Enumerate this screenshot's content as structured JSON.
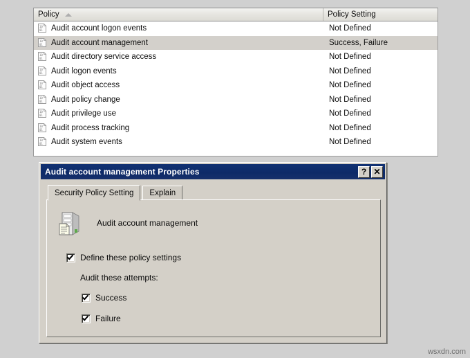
{
  "list": {
    "columns": [
      {
        "key": "policy",
        "label": "Policy",
        "sorted": true,
        "sort_direction": "ascending",
        "sort_icon": "sort-ascending-arrow-icon"
      },
      {
        "key": "setting",
        "label": "Policy Setting",
        "sorted": false
      }
    ],
    "rows": [
      {
        "icon": "audit-policy-icon",
        "policy": "Audit account logon events",
        "setting": "Not Defined",
        "selected": false
      },
      {
        "icon": "audit-policy-icon",
        "policy": "Audit account management",
        "setting": "Success, Failure",
        "selected": true
      },
      {
        "icon": "audit-policy-icon",
        "policy": "Audit directory service access",
        "setting": "Not Defined",
        "selected": false
      },
      {
        "icon": "audit-policy-icon",
        "policy": "Audit logon events",
        "setting": "Not Defined",
        "selected": false
      },
      {
        "icon": "audit-policy-icon",
        "policy": "Audit object access",
        "setting": "Not Defined",
        "selected": false
      },
      {
        "icon": "audit-policy-icon",
        "policy": "Audit policy change",
        "setting": "Not Defined",
        "selected": false
      },
      {
        "icon": "audit-policy-icon",
        "policy": "Audit privilege use",
        "setting": "Not Defined",
        "selected": false
      },
      {
        "icon": "audit-policy-icon",
        "policy": "Audit process tracking",
        "setting": "Not Defined",
        "selected": false
      },
      {
        "icon": "audit-policy-icon",
        "policy": "Audit system events",
        "setting": "Not Defined",
        "selected": false
      }
    ]
  },
  "dialog": {
    "title": "Audit account management Properties",
    "titlebar_color": "#0d2a68",
    "help_button": "?",
    "close_button": "✕",
    "tabs": [
      {
        "label": "Security Policy Setting",
        "active": true
      },
      {
        "label": "Explain",
        "active": false
      }
    ],
    "policy_icon": "server-policy-icon",
    "policy_name": "Audit account management",
    "define_checkbox": {
      "label": "Define these policy settings",
      "checked": true
    },
    "attempts_label": "Audit these attempts:",
    "attempt_options": [
      {
        "label": "Success",
        "checked": true
      },
      {
        "label": "Failure",
        "checked": true
      }
    ]
  },
  "watermark": "wsxdn.com"
}
